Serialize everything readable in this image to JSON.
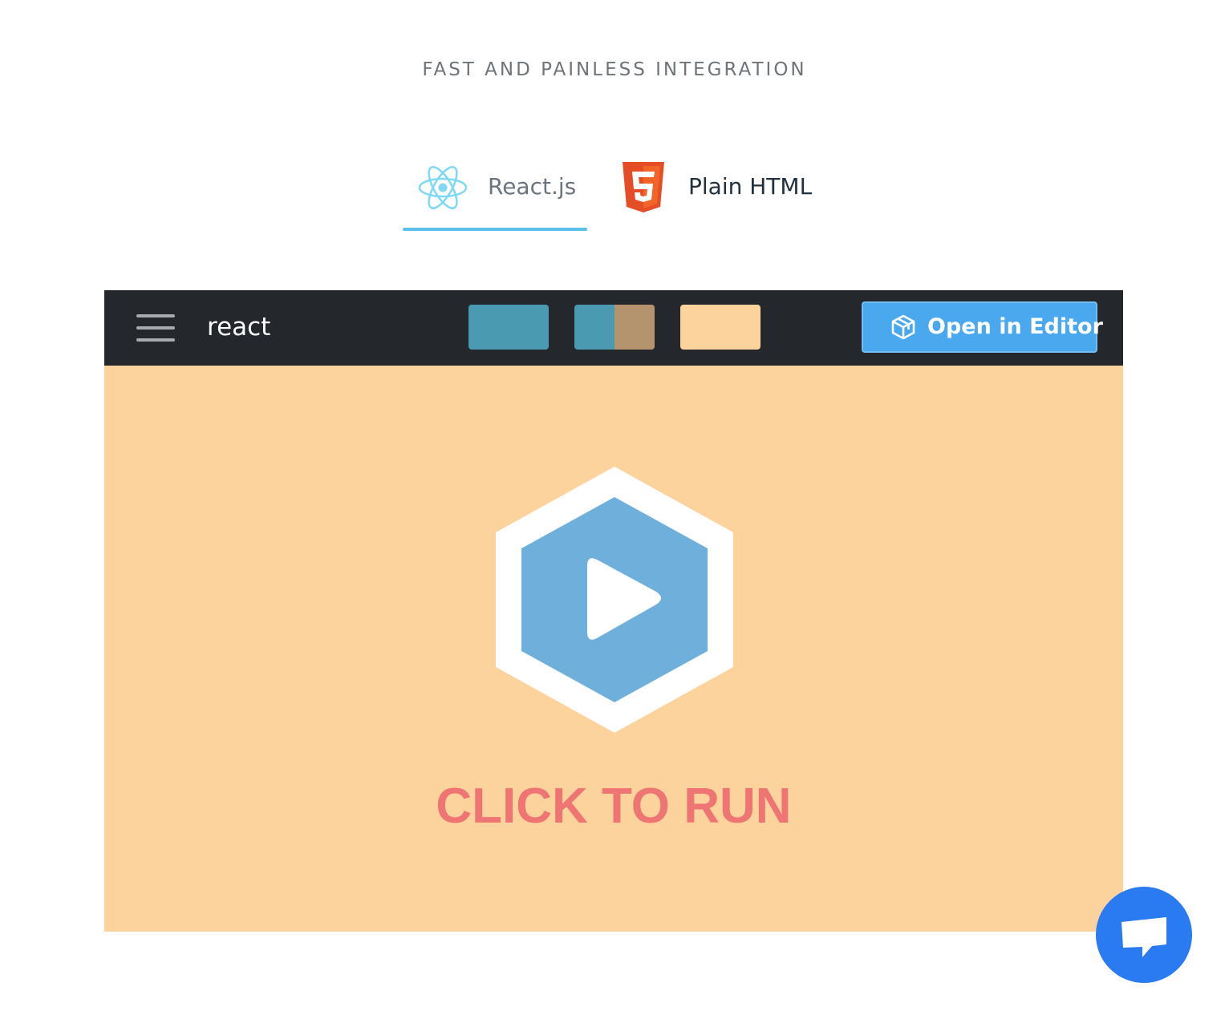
{
  "section": {
    "heading": "FAST AND PAINLESS INTEGRATION"
  },
  "tabs": [
    {
      "label": "React.js",
      "icon": "react-icon",
      "active": true
    },
    {
      "label": "Plain HTML",
      "icon": "html5-icon",
      "active": false
    }
  ],
  "embed": {
    "title": "react",
    "menu_icon": "hamburger-icon",
    "layout_buttons": [
      "layout-editor-only",
      "layout-split",
      "layout-preview-only"
    ],
    "open_editor_label": "Open in Editor",
    "open_editor_icon": "cube-icon",
    "run_label": "CLICK TO RUN",
    "play_icon": "play-icon"
  },
  "chat": {
    "icon": "chat-bubble-icon"
  },
  "colors": {
    "accent": "#5bc0eb",
    "toolbar": "#24282c",
    "preview_bg": "#fcd39d",
    "editor_button": "#4aa8ee",
    "run_text": "#ef7574",
    "hexagon": "#6eafdb",
    "chat": "#2a7af2"
  }
}
